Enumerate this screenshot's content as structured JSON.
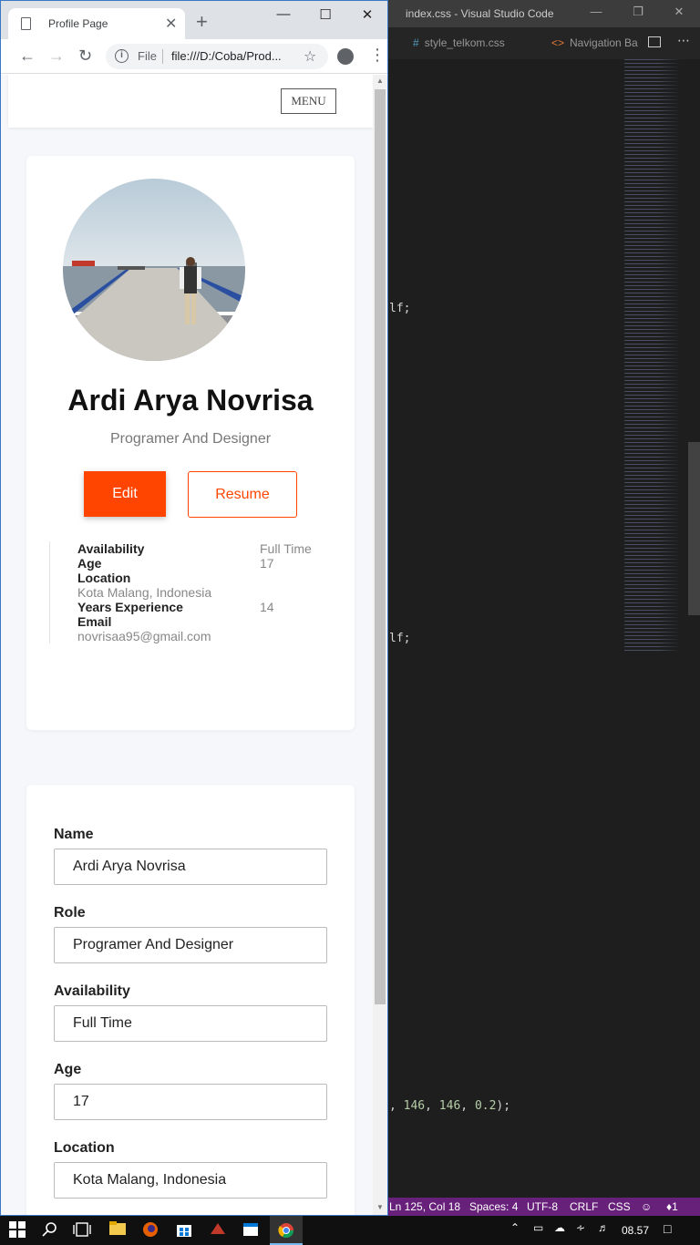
{
  "vscode": {
    "title": "index.css - Visual Studio Code",
    "tabs": [
      {
        "label": "style_telkom.css",
        "icon": "hash-icon"
      },
      {
        "label": "Navigation Ba",
        "icon": "html-icon"
      }
    ],
    "code_fragments": [
      "lf;",
      "lf;"
    ],
    "code_rgba": {
      "prefix": ", ",
      "a": "146",
      "sep1": ", ",
      "b": "146",
      "sep2": ", ",
      "c": "0.2",
      "suffix": ");"
    },
    "status": {
      "position": "Ln 125, Col 18",
      "spaces": "Spaces: 4",
      "encoding": "UTF-8",
      "eol": "CRLF",
      "language": "CSS",
      "notifications": "1"
    },
    "status_color": "#68217a"
  },
  "browser": {
    "tab_title": "Profile Page",
    "omnibox": {
      "scheme_label": "File",
      "url": "file:///D:/Coba/Prod..."
    }
  },
  "page": {
    "menu_label": "MENU",
    "profile": {
      "name": "Ardi Arya Novrisa",
      "role": "Programer And Designer",
      "edit_label": "Edit",
      "resume_label": "Resume",
      "accent_color": "#ff4500",
      "info": [
        {
          "label": "Availability",
          "value": "Full Time"
        },
        {
          "label": "Age",
          "value": "17"
        },
        {
          "label": "Location",
          "value": "Kota Malang, Indonesia"
        },
        {
          "label": "Years Experience",
          "value": "14"
        },
        {
          "label": "Email",
          "value": "novrisaa95@gmail.com"
        }
      ]
    },
    "form": [
      {
        "label": "Name",
        "value": "Ardi Arya Novrisa"
      },
      {
        "label": "Role",
        "value": "Programer And Designer"
      },
      {
        "label": "Availability",
        "value": "Full Time"
      },
      {
        "label": "Age",
        "value": "17"
      },
      {
        "label": "Location",
        "value": "Kota Malang, Indonesia"
      }
    ]
  },
  "taskbar": {
    "clock": "08.57"
  }
}
